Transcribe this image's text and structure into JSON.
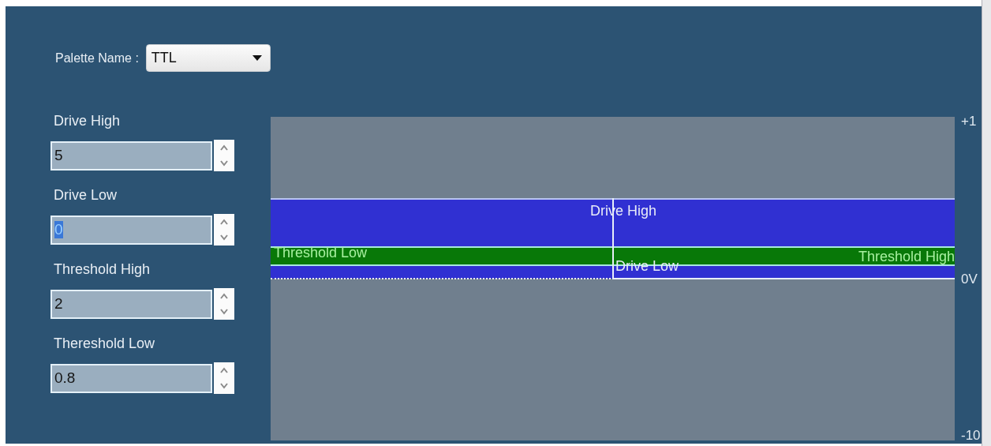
{
  "palette": {
    "label": "Palette Name :",
    "value": "TTL"
  },
  "fields": [
    {
      "label": "Drive High",
      "value": "5",
      "focused": false
    },
    {
      "label": "Drive Low",
      "value": "0",
      "focused": true
    },
    {
      "label": "Threshold High",
      "value": "2",
      "focused": false
    },
    {
      "label": "Thereshold Low",
      "value": "0.8",
      "focused": false
    }
  ],
  "diagram": {
    "drive_high_label": "Drive High",
    "drive_low_label": "Drive Low",
    "threshold_low_label": "Threshold Low",
    "threshold_high_label": "Threshold High",
    "axis_labels": [
      "+1",
      "0V",
      "-10"
    ]
  }
}
